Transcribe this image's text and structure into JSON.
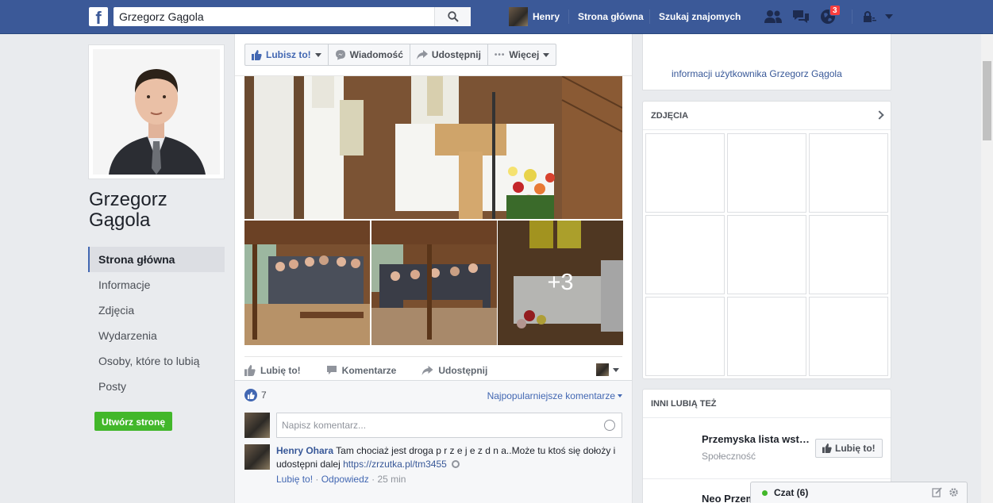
{
  "topbar": {
    "logo": "f",
    "search_value": "Grzegorz Gągola",
    "user_name": "Henry",
    "home_label": "Strona główna",
    "find_friends_label": "Szukaj znajomych",
    "notifications_count": "3",
    "icons": [
      "friend-requests-icon",
      "messages-icon",
      "notifications-globe-icon",
      "privacy-lock-icon",
      "account-menu-caret-icon"
    ],
    "brand_color": "#3b5998"
  },
  "profile": {
    "name": "Grzegorz Gągola"
  },
  "sidebar": {
    "items": [
      {
        "label": "Strona główna",
        "active": true
      },
      {
        "label": "Informacje"
      },
      {
        "label": "Zdjęcia"
      },
      {
        "label": "Wydarzenia"
      },
      {
        "label": "Osoby, które to lubią"
      },
      {
        "label": "Posty"
      }
    ],
    "create_page_label": "Utwórz stronę"
  },
  "page_actions": {
    "like_label": "Lubisz to!",
    "message_label": "Wiadomość",
    "share_label": "Udostępnij",
    "more_label": "Więcej"
  },
  "post": {
    "more_photos_label": "+3",
    "like_label": "Lubię to!",
    "comment_label": "Komentarze",
    "share_label": "Udostępnij",
    "likes_count": "7",
    "sort_label": "Najpopularniejsze komentarze",
    "comment_placeholder": "Napisz komentarz...",
    "comment": {
      "author": "Henry Ohara",
      "text": "Tam chociaż jest droga p r z e j e z d n a..Może tu ktoś się dołoży i udostępni dalej",
      "link": "https://zrzutka.pl/tm3455",
      "like_action": "Lubię to!",
      "reply_action": "Odpowiedz",
      "time": "25 min"
    }
  },
  "right": {
    "intro_text": "informacji użytkownika Grzegorz Gągola",
    "photos_title": "ZDJĘCIA",
    "others_like_title": "INNI LUBIĄ TEŻ",
    "others": [
      {
        "name": "Przemyska lista wst…",
        "category": "Społeczność",
        "like_label": "Lubię to!"
      },
      {
        "name": "Neo Przem"
      }
    ]
  },
  "chat": {
    "label": "Czat (6)",
    "status_color": "#42b72a"
  }
}
